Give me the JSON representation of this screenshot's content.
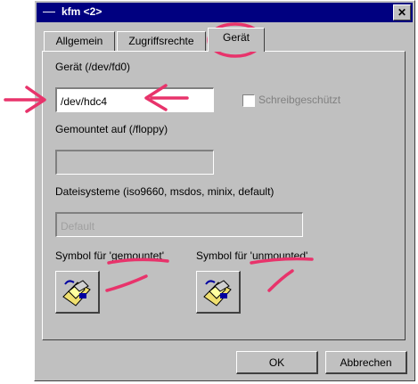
{
  "window": {
    "title": "kfm <2>",
    "menu_glyph": "—",
    "close_glyph": "✕"
  },
  "tabs": [
    {
      "label": "Allgemein"
    },
    {
      "label": "Zugriffsrechte"
    },
    {
      "label": "Gerät",
      "active": true
    }
  ],
  "device": {
    "label": "Gerät (/dev/fd0)",
    "value": "/dev/hdc4",
    "readonly_label": "Schreibgeschützt"
  },
  "mountpoint": {
    "label": "Gemountet auf (/floppy)",
    "value": ""
  },
  "filesystems": {
    "label": "Dateisysteme (iso9660, msdos, minix, default)",
    "placeholder": "Default"
  },
  "icons": {
    "mounted_label_prefix": "Symbol für '",
    "mounted_label_word": "gemountet",
    "mounted_label_suffix": "'",
    "unmounted_label_prefix": "Symbol für '",
    "unmounted_label_word": "unmounted",
    "unmounted_label_suffix": "'"
  },
  "buttons": {
    "ok": "OK",
    "cancel": "Abbrechen"
  },
  "annotations": {
    "color": "#e8336b"
  }
}
